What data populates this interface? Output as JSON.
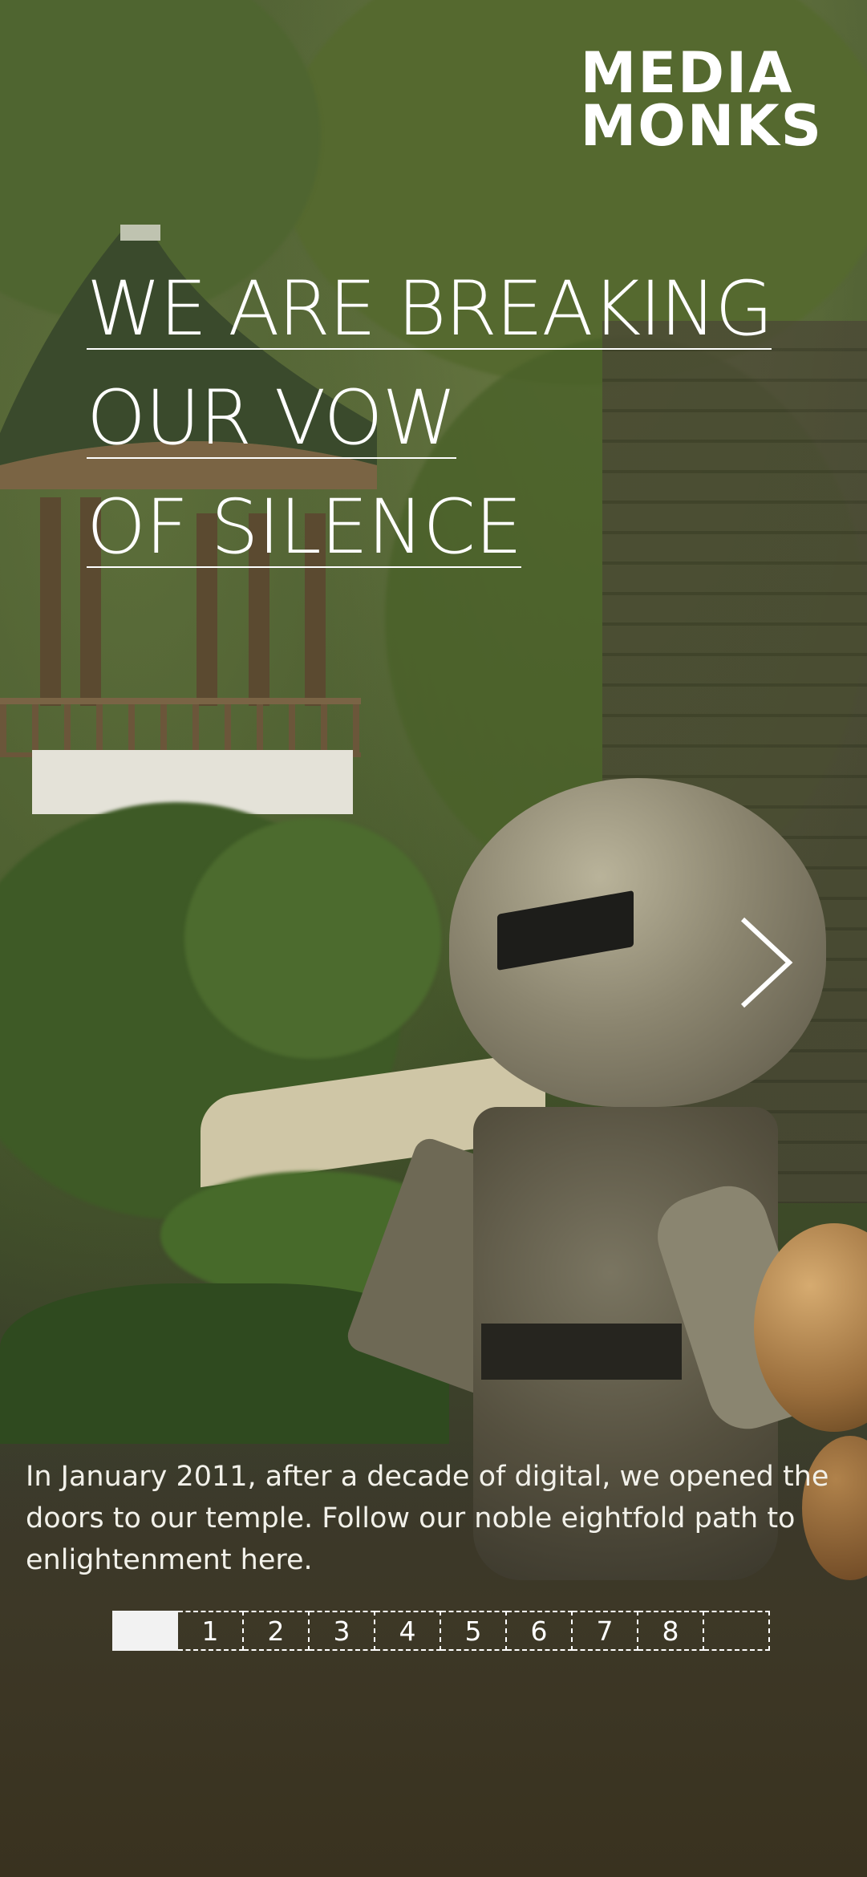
{
  "brand": {
    "logo_line1": "MEDIA",
    "logo_line2": "MONKS"
  },
  "headline": {
    "line1": "WE ARE BREAKING",
    "line2": "OUR VOW",
    "line3": "OF SILENCE"
  },
  "intro": {
    "text": "In January 2011, after a decade of digital, we opened the doors to our temple. Follow our noble eightfold path to enlightenment here."
  },
  "navigation": {
    "next_icon": "chevron-right-icon"
  },
  "pager": {
    "active_index": 0,
    "pages": [
      "",
      "1",
      "2",
      "3",
      "4",
      "5",
      "6",
      "7",
      "8",
      ""
    ]
  },
  "colors": {
    "text": "#ffffff",
    "pager_active": "#f2f2f2"
  }
}
